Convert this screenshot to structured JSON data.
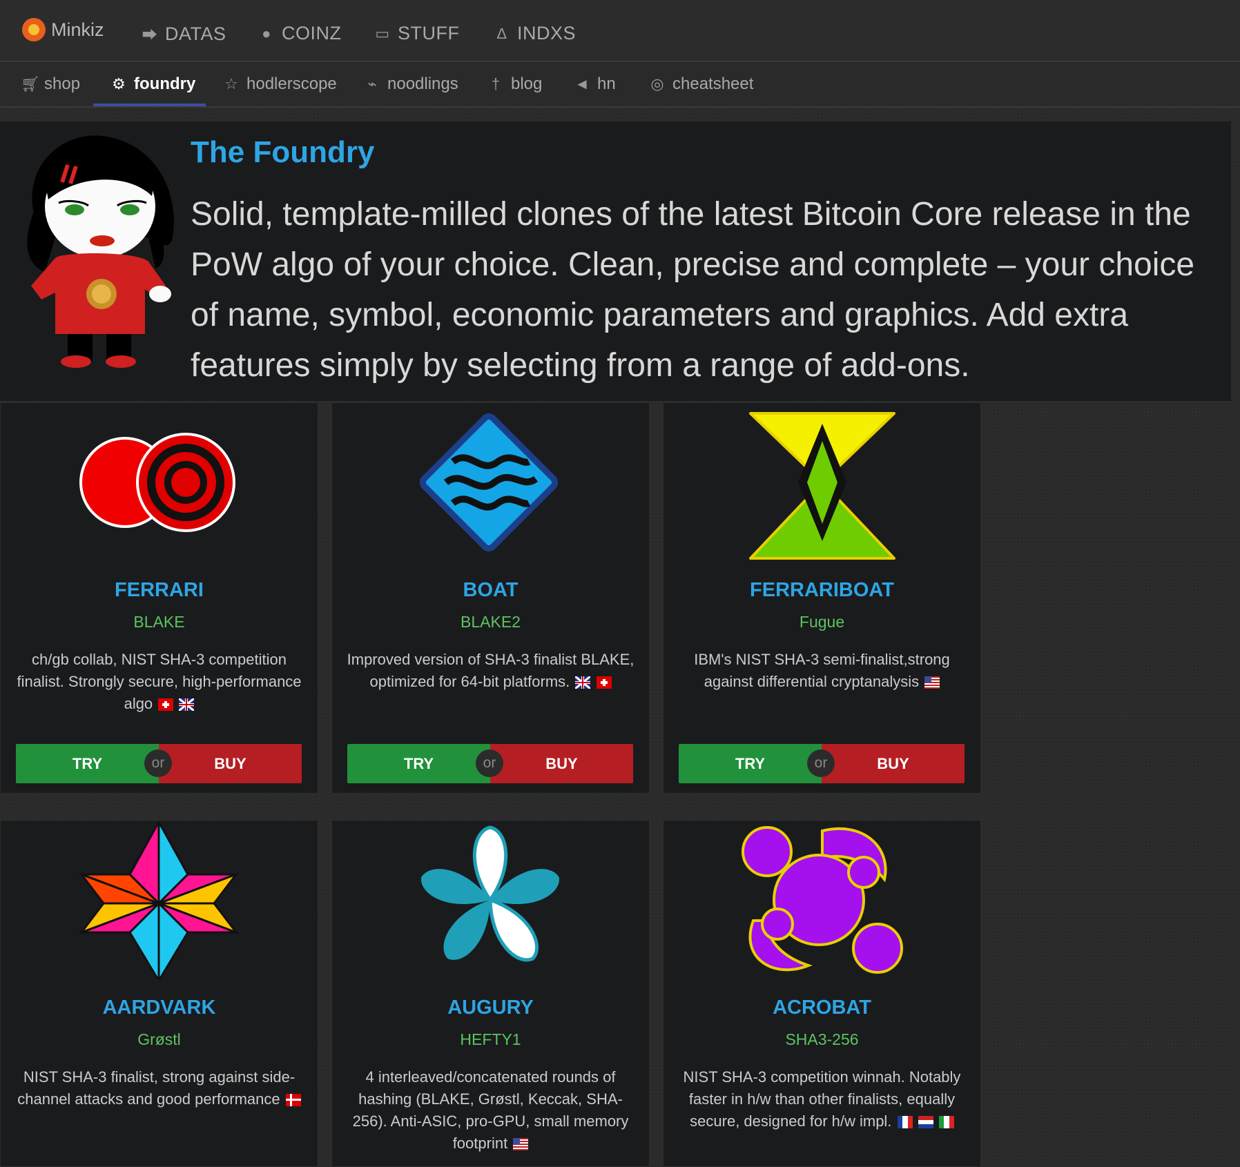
{
  "topnav": {
    "brand": "Minkiz",
    "items": [
      {
        "label": "DATAS",
        "icon": "share-icon"
      },
      {
        "label": "COINZ",
        "icon": "coin-icon"
      },
      {
        "label": "STUFF",
        "icon": "card-icon"
      },
      {
        "label": "INDXS",
        "icon": "flask-icon"
      }
    ]
  },
  "subnav": {
    "items": [
      {
        "label": "shop",
        "icon": "cart-icon"
      },
      {
        "label": "foundry",
        "icon": "cogs-icon"
      },
      {
        "label": "hodlerscope",
        "icon": "star-icon"
      },
      {
        "label": "noodlings",
        "icon": "plug-icon"
      },
      {
        "label": "blog",
        "icon": "pin-icon"
      },
      {
        "label": "hn",
        "icon": "megaphone-icon"
      },
      {
        "label": "cheatsheet",
        "icon": "target-icon"
      }
    ],
    "active": "foundry"
  },
  "hero": {
    "title": "The Foundry",
    "text": "Solid, template-milled clones of the latest Bitcoin Core release in the PoW algo of your choice. Clean, precise and complete – your choice of name, symbol, economic parameters and graphics. Add extra features simply by selecting from a range of add-ons."
  },
  "buttons": {
    "try": "TRY",
    "or": "or",
    "buy": "BUY"
  },
  "cards": [
    {
      "name": "FERRARI",
      "algo": "BLAKE",
      "desc": "ch/gb collab, NIST SHA-3 competition finalist. Strongly secure, high-performance algo",
      "flags": [
        "ch",
        "gb"
      ]
    },
    {
      "name": "BOAT",
      "algo": "BLAKE2",
      "desc": "Improved version of SHA-3 finalist BLAKE, optimized for 64-bit platforms.",
      "flags": [
        "gb",
        "ch"
      ]
    },
    {
      "name": "FERRARIBOAT",
      "algo": "Fugue",
      "desc": "IBM's NIST SHA-3 semi-finalist,strong against differential cryptanalysis",
      "flags": [
        "us"
      ]
    },
    {
      "name": "AARDVARK",
      "algo": "Grøstl",
      "desc": "NIST SHA-3 finalist, strong against side-channel attacks and good performance",
      "flags": [
        "dk"
      ]
    },
    {
      "name": "AUGURY",
      "algo": "HEFTY1",
      "desc": "4 interleaved/concatenated rounds of hashing (BLAKE, Grøstl, Keccak, SHA-256). Anti-ASIC, pro-GPU, small memory footprint",
      "flags": [
        "us"
      ]
    },
    {
      "name": "ACROBAT",
      "algo": "SHA3-256",
      "desc": "NIST SHA-3 competition winnah. Notably faster in h/w than other finalists, equally secure, designed for h/w impl.",
      "flags": [
        "fr",
        "nl",
        "it"
      ]
    }
  ]
}
